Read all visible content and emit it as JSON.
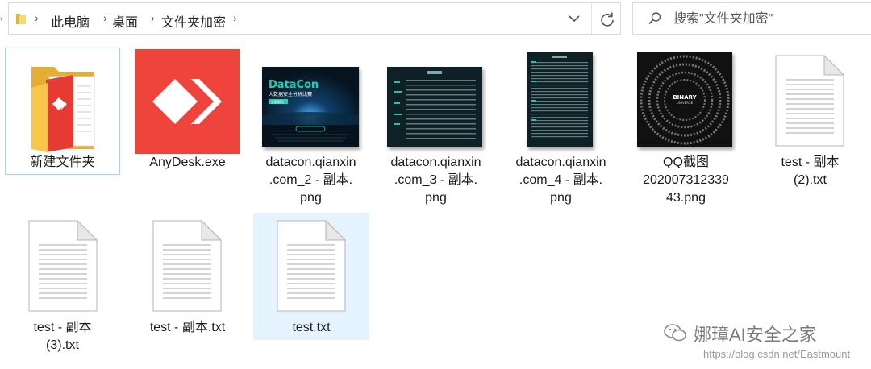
{
  "address_bar": {
    "breadcrumbs": [
      "此电脑",
      "桌面",
      "文件夹加密"
    ]
  },
  "search": {
    "placeholder": "搜索\"文件夹加密\""
  },
  "files": [
    {
      "name": "新建文件夹",
      "type": "folder",
      "icon": "folder-icon",
      "state": "hover"
    },
    {
      "name": "AnyDesk.exe",
      "type": "exe",
      "icon": "anydesk-icon",
      "accent": "#ef443b"
    },
    {
      "name": "datacon.qianxin\n.com_2 - 副本.\npng",
      "type": "png",
      "thumb_title": "DataCon",
      "thumb_subtitle": "大数据安全分析比赛",
      "thumb_badge": "立即报名"
    },
    {
      "name": "datacon.qianxin\n.com_3 - 副本.\npng",
      "type": "png"
    },
    {
      "name": "datacon.qianxin\n.com_4 - 副本.\npng",
      "type": "png"
    },
    {
      "name": "QQ截图\n202007312339\n43.png",
      "type": "png",
      "thumb_title": "BINARY",
      "thumb_subtitle": "UNIVERSE"
    },
    {
      "name": "test - 副本\n(2).txt",
      "type": "txt"
    },
    {
      "name": "test - 副本\n(3).txt",
      "type": "txt"
    },
    {
      "name": "test - 副本.txt",
      "type": "txt"
    },
    {
      "name": "test.txt",
      "type": "txt",
      "state": "selected"
    }
  ],
  "watermark": {
    "brand": "娜璋AI安全之家",
    "url": "https://blog.csdn.net/Eastmount"
  },
  "colors": {
    "folder_yellow": "#f8c74a",
    "anydesk_red": "#ef443b",
    "hover_border": "#99d1ff",
    "selected_bg": "#e5f3ff",
    "datacon_accent": "#21d0b2"
  }
}
